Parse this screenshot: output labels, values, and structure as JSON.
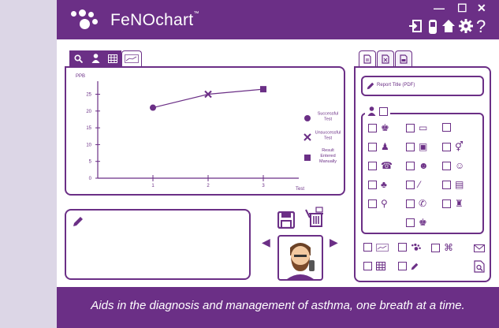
{
  "app": {
    "brand_name": "FeNOchart",
    "brand_tm": "™",
    "footer_text": "Aids in the diagnosis and management of asthma, one breath at a time."
  },
  "window_controls": {
    "minimize": "—",
    "maximize": "☐",
    "close": "✕"
  },
  "toolbar": {
    "help_label": "?"
  },
  "chart_tabs": [
    {
      "icon": "search-icon"
    },
    {
      "icon": "user-icon"
    },
    {
      "icon": "table-icon"
    },
    {
      "icon": "chart-thumbnail-icon",
      "active": true
    }
  ],
  "chart_data": {
    "type": "line",
    "ylabel": "PPB",
    "xlabel": "Test",
    "x": [
      1,
      2,
      3
    ],
    "xlim": [
      0,
      3.5
    ],
    "ylim": [
      0,
      27
    ],
    "yticks": [
      0,
      5,
      10,
      15,
      20,
      25
    ],
    "xticks": [
      1,
      2,
      3
    ],
    "points": [
      {
        "x": 1,
        "y": 21,
        "marker": "circle"
      },
      {
        "x": 2,
        "y": 25,
        "marker": "x"
      },
      {
        "x": 3,
        "y": 26.5,
        "marker": "square"
      }
    ],
    "legend": [
      {
        "marker": "circle",
        "label": "Successful Test"
      },
      {
        "marker": "x",
        "label": "Unsuccessful Test"
      },
      {
        "marker": "square",
        "label": "Result Entered Manually"
      }
    ],
    "color": "#6b2f86"
  },
  "report": {
    "title_placeholder": "Report Title (PDF)"
  },
  "right_tabs": [
    {
      "icon": "document-icon",
      "active": true
    },
    {
      "icon": "excel-icon"
    },
    {
      "icon": "print-document-icon"
    }
  ],
  "notes": {
    "placeholder": ""
  },
  "nav": {
    "prev": "◀",
    "next": "▶"
  },
  "colors": {
    "primary": "#6b2f86",
    "background": "#ffffff",
    "left_strip": "#dcd6e6"
  }
}
